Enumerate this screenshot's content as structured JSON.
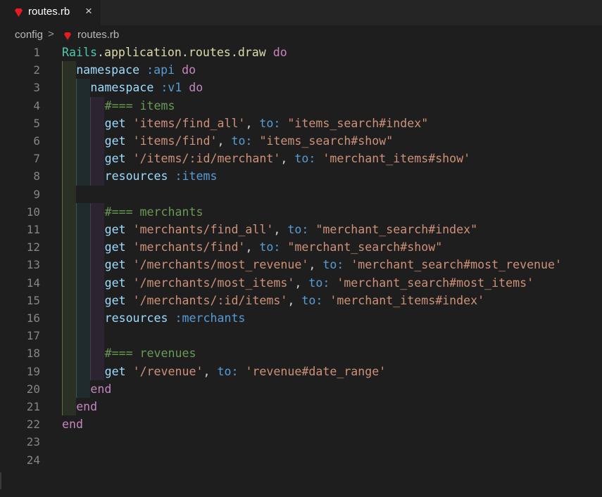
{
  "tab": {
    "filename": "routes.rb",
    "close": "×"
  },
  "breadcrumb": {
    "folder": "config",
    "separator": ">",
    "file": "routes.rb"
  },
  "colors": {
    "ruby_icon": "#e51b24",
    "background": "#1e1e1e"
  },
  "lines": [
    {
      "n": "1",
      "indent": 0,
      "tokens": [
        [
          "cls",
          "Rails"
        ],
        [
          "p",
          "."
        ],
        [
          "fn",
          "application"
        ],
        [
          "p",
          "."
        ],
        [
          "fn",
          "routes"
        ],
        [
          "p",
          "."
        ],
        [
          "fn",
          "draw"
        ],
        [
          "p",
          " "
        ],
        [
          "kw",
          "do"
        ]
      ]
    },
    {
      "n": "2",
      "indent": 1,
      "tokens": [
        [
          "id",
          "namespace"
        ],
        [
          "p",
          " "
        ],
        [
          "sym",
          ":api"
        ],
        [
          "p",
          " "
        ],
        [
          "kw",
          "do"
        ]
      ]
    },
    {
      "n": "3",
      "indent": 2,
      "tokens": [
        [
          "id",
          "namespace"
        ],
        [
          "p",
          " "
        ],
        [
          "sym",
          ":v1"
        ],
        [
          "p",
          " "
        ],
        [
          "kw",
          "do"
        ]
      ]
    },
    {
      "n": "4",
      "indent": 3,
      "tokens": [
        [
          "cm",
          "#=== items"
        ]
      ]
    },
    {
      "n": "5",
      "indent": 3,
      "tokens": [
        [
          "id",
          "get"
        ],
        [
          "p",
          " "
        ],
        [
          "str",
          "'items/find_all'"
        ],
        [
          "p",
          ", "
        ],
        [
          "sym",
          "to:"
        ],
        [
          "p",
          " "
        ],
        [
          "str",
          "\"items_search#index\""
        ]
      ]
    },
    {
      "n": "6",
      "indent": 3,
      "tokens": [
        [
          "id",
          "get"
        ],
        [
          "p",
          " "
        ],
        [
          "str",
          "'items/find'"
        ],
        [
          "p",
          ", "
        ],
        [
          "sym",
          "to:"
        ],
        [
          "p",
          " "
        ],
        [
          "str",
          "\"items_search#show\""
        ]
      ]
    },
    {
      "n": "7",
      "indent": 3,
      "tokens": [
        [
          "id",
          "get"
        ],
        [
          "p",
          " "
        ],
        [
          "str",
          "'/items/:id/merchant'"
        ],
        [
          "p",
          ", "
        ],
        [
          "sym",
          "to:"
        ],
        [
          "p",
          " "
        ],
        [
          "str",
          "'merchant_items#show'"
        ]
      ]
    },
    {
      "n": "8",
      "indent": 3,
      "tokens": [
        [
          "id",
          "resources"
        ],
        [
          "p",
          " "
        ],
        [
          "sym",
          ":items"
        ]
      ]
    },
    {
      "n": "9",
      "indent": 1,
      "tokens": []
    },
    {
      "n": "10",
      "indent": 3,
      "tokens": [
        [
          "cm",
          "#=== merchants"
        ]
      ]
    },
    {
      "n": "11",
      "indent": 3,
      "tokens": [
        [
          "id",
          "get"
        ],
        [
          "p",
          " "
        ],
        [
          "str",
          "'merchants/find_all'"
        ],
        [
          "p",
          ", "
        ],
        [
          "sym",
          "to:"
        ],
        [
          "p",
          " "
        ],
        [
          "str",
          "\"merchant_search#index\""
        ]
      ]
    },
    {
      "n": "12",
      "indent": 3,
      "tokens": [
        [
          "id",
          "get"
        ],
        [
          "p",
          " "
        ],
        [
          "str",
          "'merchants/find'"
        ],
        [
          "p",
          ", "
        ],
        [
          "sym",
          "to:"
        ],
        [
          "p",
          " "
        ],
        [
          "str",
          "\"merchant_search#show\""
        ]
      ]
    },
    {
      "n": "13",
      "indent": 3,
      "tokens": [
        [
          "id",
          "get"
        ],
        [
          "p",
          " "
        ],
        [
          "str",
          "'/merchants/most_revenue'"
        ],
        [
          "p",
          ", "
        ],
        [
          "sym",
          "to:"
        ],
        [
          "p",
          " "
        ],
        [
          "str",
          "'merchant_search#most_revenue'"
        ]
      ]
    },
    {
      "n": "14",
      "indent": 3,
      "tokens": [
        [
          "id",
          "get"
        ],
        [
          "p",
          " "
        ],
        [
          "str",
          "'/merchants/most_items'"
        ],
        [
          "p",
          ", "
        ],
        [
          "sym",
          "to:"
        ],
        [
          "p",
          " "
        ],
        [
          "str",
          "'merchant_search#most_items'"
        ]
      ]
    },
    {
      "n": "15",
      "indent": 3,
      "tokens": [
        [
          "id",
          "get"
        ],
        [
          "p",
          " "
        ],
        [
          "str",
          "'/merchants/:id/items'"
        ],
        [
          "p",
          ", "
        ],
        [
          "sym",
          "to:"
        ],
        [
          "p",
          " "
        ],
        [
          "str",
          "'merchant_items#index'"
        ]
      ]
    },
    {
      "n": "16",
      "indent": 3,
      "tokens": [
        [
          "id",
          "resources"
        ],
        [
          "p",
          " "
        ],
        [
          "sym",
          ":merchants"
        ]
      ]
    },
    {
      "n": "17",
      "indent": 3,
      "tokens": []
    },
    {
      "n": "18",
      "indent": 3,
      "tokens": [
        [
          "cm",
          "#=== revenues"
        ]
      ]
    },
    {
      "n": "19",
      "indent": 3,
      "tokens": [
        [
          "id",
          "get"
        ],
        [
          "p",
          " "
        ],
        [
          "str",
          "'/revenue'"
        ],
        [
          "p",
          ", "
        ],
        [
          "sym",
          "to:"
        ],
        [
          "p",
          " "
        ],
        [
          "str",
          "'revenue#date_range'"
        ]
      ]
    },
    {
      "n": "20",
      "indent": 2,
      "tokens": [
        [
          "kw",
          "end"
        ]
      ]
    },
    {
      "n": "21",
      "indent": 1,
      "tokens": [
        [
          "kw",
          "end"
        ]
      ]
    },
    {
      "n": "22",
      "indent": 0,
      "tokens": [
        [
          "kw",
          "end"
        ]
      ]
    },
    {
      "n": "23",
      "indent": 0,
      "tokens": []
    },
    {
      "n": "24",
      "indent": 0,
      "tokens": []
    }
  ]
}
